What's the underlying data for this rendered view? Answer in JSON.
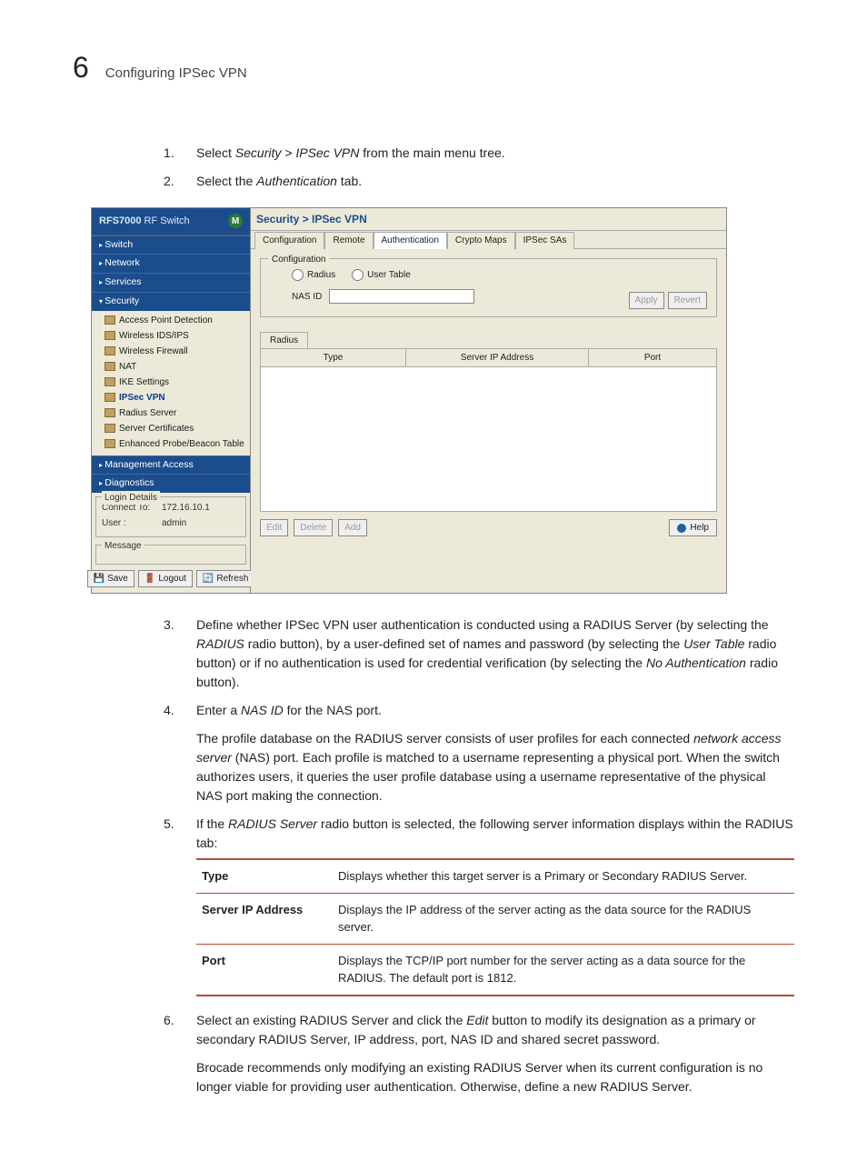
{
  "header": {
    "chapter": "6",
    "title": "Configuring IPSec VPN"
  },
  "steps": {
    "s1": {
      "num": "1.",
      "pre": "Select ",
      "em": "Security > IPSec VPN",
      "post": " from the main menu tree."
    },
    "s2": {
      "num": "2.",
      "pre": "Select the ",
      "em": "Authentication",
      "post": " tab."
    },
    "s3": {
      "num": "3.",
      "t1": "Define whether IPSec VPN user authentication is conducted using a RADIUS Server (by selecting the ",
      "em1": "RADIUS",
      "t2": " radio button), by a user-defined set of names and password (by selecting the ",
      "em2": "User Table",
      "t3": " radio button) or if no authentication is used for credential verification (by selecting the ",
      "em3": "No Authentication",
      "t4": " radio button)."
    },
    "s4": {
      "num": "4.",
      "t1": "Enter a ",
      "em1": "NAS ID",
      "t2": " for the NAS port.",
      "p2a": "The profile database on the RADIUS server consists of user profiles for each connected ",
      "p2em": "network access server",
      "p2b": " (NAS) port. Each profile is matched to a username representing a physical port. When the switch authorizes users, it queries the user profile database using a username representative of the physical NAS port making the connection."
    },
    "s5": {
      "num": "5.",
      "t1": "If the ",
      "em1": "RADIUS Server",
      "t2": " radio button is selected, the following server information displays within the RADIUS tab:"
    },
    "s6": {
      "num": "6.",
      "t1": "Select an existing RADIUS Server and click the ",
      "em1": "Edit",
      "t2": " button to modify its designation as a primary or secondary RADIUS Server, IP address, port, NAS ID and shared secret password.",
      "p2": "Brocade recommends only modifying an existing RADIUS Server when its current configuration is no longer viable for providing user authentication. Otherwise, define a new RADIUS Server."
    }
  },
  "deftable": {
    "r1k": "Type",
    "r1v": "Displays whether this target server is a Primary or Secondary RADIUS Server.",
    "r2k": "Server IP Address",
    "r2v": "Displays the IP address of the server acting as the data source for the RADIUS server.",
    "r3k": "Port",
    "r3v": "Displays the TCP/IP port number for the server acting as a data source for the RADIUS. The default port is 1812."
  },
  "shot": {
    "device": {
      "model_bold": "RFS7000",
      "model_rest": " RF Switch",
      "logo": "M"
    },
    "nav": {
      "switch": "Switch",
      "network": "Network",
      "services": "Services",
      "security": "Security",
      "mgmt": "Management Access",
      "diag": "Diagnostics"
    },
    "tree": {
      "apd": "Access Point Detection",
      "ids": "Wireless IDS/IPS",
      "fw": "Wireless Firewall",
      "nat": "NAT",
      "ike": "IKE Settings",
      "ipsec": "IPSec VPN",
      "radius": "Radius Server",
      "cert": "Server Certificates",
      "probe": "Enhanced Probe/Beacon Table"
    },
    "login": {
      "legend": "Login Details",
      "connk": "Connect To:",
      "connv": "172.16.10.1",
      "userk": "User :",
      "userv": "admin"
    },
    "msg_legend": "Message",
    "btns": {
      "save": "Save",
      "logout": "Logout",
      "refresh": "Refresh"
    },
    "crumb": "Security > IPSec VPN",
    "tabs": {
      "cfg": "Configuration",
      "remote": "Remote",
      "auth": "Authentication",
      "crypto": "Crypto Maps",
      "sas": "IPSec SAs"
    },
    "cfg": {
      "legend": "Configuration",
      "radius": "Radius",
      "usertable": "User Table",
      "nas_label": "NAS ID",
      "apply": "Apply",
      "revert": "Revert"
    },
    "subtab": "Radius",
    "thead": {
      "type": "Type",
      "sip": "Server IP Address",
      "port": "Port"
    },
    "footer": {
      "edit": "Edit",
      "del": "Delete",
      "add": "Add",
      "help": "Help"
    }
  }
}
